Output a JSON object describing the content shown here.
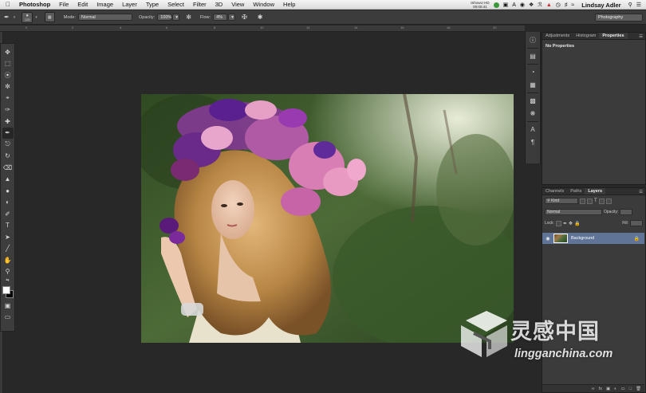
{
  "menubar": {
    "app": "Photoshop",
    "items": [
      "File",
      "Edit",
      "Image",
      "Layer",
      "Type",
      "Select",
      "Filter",
      "3D",
      "View",
      "Window",
      "Help"
    ],
    "recording": "iShowU HD",
    "timer": "00:00:41",
    "user": "Lindsay Adler"
  },
  "options": {
    "brush_size": "125",
    "mode_label": "Mode:",
    "mode_value": "Normal",
    "opacity_label": "Opacity:",
    "opacity_value": "100%",
    "flow_label": "Flow:",
    "flow_value": "4%",
    "workspace": "Photography"
  },
  "ruler": {
    "ticks": [
      "0",
      "2",
      "4",
      "6",
      "8",
      "10",
      "12",
      "14",
      "16",
      "18",
      "20"
    ]
  },
  "properties_panel": {
    "tabs": [
      "Adjustments",
      "Histogram",
      "Properties"
    ],
    "active_tab": "Properties",
    "content": "No Properties"
  },
  "layers_panel": {
    "tabs": [
      "Channels",
      "Paths",
      "Layers"
    ],
    "active_tab": "Layers",
    "filter_kind": "Kind",
    "blend_mode": "Normal",
    "opacity_label": "Opacity:",
    "lock_label": "Lock:",
    "fill_label": "Fill:",
    "layers": [
      {
        "name": "Background",
        "visible": true,
        "locked": true
      }
    ]
  },
  "watermark": {
    "cn": "灵感中国",
    "en": "lingganchina.com"
  },
  "colors": {
    "foreground": "#ffffff",
    "background": "#000000",
    "selected_layer": "#5f7497"
  }
}
